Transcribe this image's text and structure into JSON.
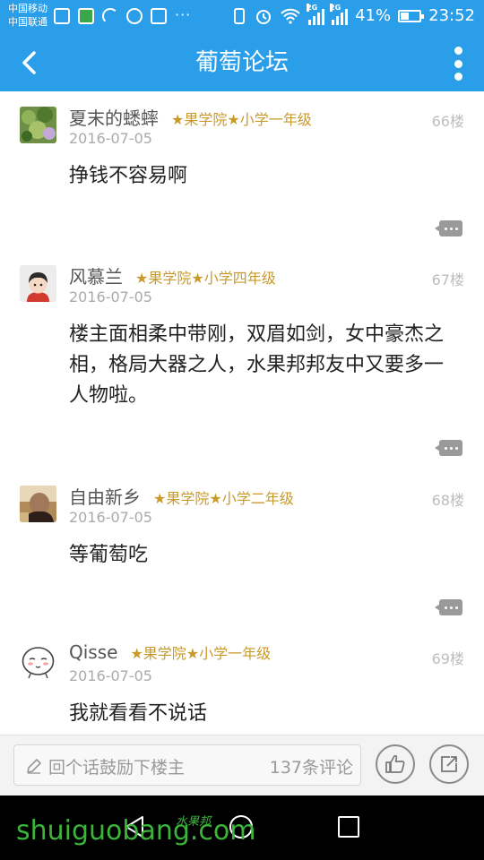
{
  "status_bar": {
    "carrier_1": "中国移动",
    "carrier_2": "中国联通",
    "dots": "···",
    "network_1": "2G",
    "network_2": "2G",
    "battery": "41%",
    "battery_level": 0.41,
    "time": "23:52"
  },
  "app_bar": {
    "title": "葡萄论坛"
  },
  "posts": [
    {
      "name": "夏末的蟋蟀",
      "rank": "★果学院★小学一年级",
      "floor": "66楼",
      "date": "2016-07-05",
      "content": "挣钱不容易啊"
    },
    {
      "name": "风慕兰",
      "rank": "★果学院★小学四年级",
      "floor": "67楼",
      "date": "2016-07-05",
      "content": "楼主面相柔中带刚，双眉如剑，女中豪杰之相，格局大器之人，水果邦邦友中又要多一人物啦。"
    },
    {
      "name": "自由新乡",
      "rank": "★果学院★小学二年级",
      "floor": "68楼",
      "date": "2016-07-05",
      "content": "等葡萄吃"
    },
    {
      "name": "Qisse",
      "rank": "★果学院★小学一年级",
      "floor": "69楼",
      "date": "2016-07-05",
      "content": "我就看看不说话"
    }
  ],
  "bottom_bar": {
    "comment_placeholder": "回个话鼓励下楼主",
    "comment_count": "137条评论"
  },
  "watermark": {
    "text": "shuiguobang.com",
    "cn": "水果邦"
  },
  "colors": {
    "accent": "#2a9ee8",
    "rank": "#c89a2a"
  }
}
